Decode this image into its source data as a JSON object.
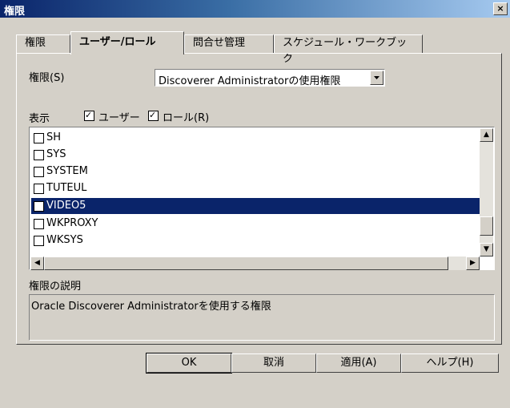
{
  "window": {
    "title": "権限",
    "close_label": "×"
  },
  "tabs": [
    {
      "label": "権限",
      "active": false
    },
    {
      "label": "ユーザー/ロール",
      "active": true
    },
    {
      "label": "問合せ管理",
      "active": false
    },
    {
      "label": "スケジュール・ワークブック",
      "active": false
    }
  ],
  "privilege": {
    "label": "権限(S)",
    "selected": "Discoverer Administratorの使用権限"
  },
  "display": {
    "label": "表示",
    "user_label": "ユーザー",
    "user_checked": true,
    "role_label": "ロール(R)",
    "role_checked": true
  },
  "list": {
    "items": [
      {
        "name": "SH",
        "checked": false,
        "selected": false
      },
      {
        "name": "SYS",
        "checked": false,
        "selected": false
      },
      {
        "name": "SYSTEM",
        "checked": false,
        "selected": false
      },
      {
        "name": "TUTEUL",
        "checked": false,
        "selected": false
      },
      {
        "name": "VIDEO5",
        "checked": true,
        "selected": true
      },
      {
        "name": "WKPROXY",
        "checked": false,
        "selected": false
      },
      {
        "name": "WKSYS",
        "checked": false,
        "selected": false
      }
    ]
  },
  "description": {
    "label": "権限の説明",
    "text": "Oracle Discoverer Administratorを使用する権限"
  },
  "buttons": {
    "ok": "OK",
    "cancel": "取消",
    "apply": "適用(A)",
    "help": "ヘルプ(H)"
  },
  "icons": {
    "scroll_up": "▲",
    "scroll_down": "▼",
    "scroll_left": "◀",
    "scroll_right": "▶",
    "dropdown": "▼"
  }
}
